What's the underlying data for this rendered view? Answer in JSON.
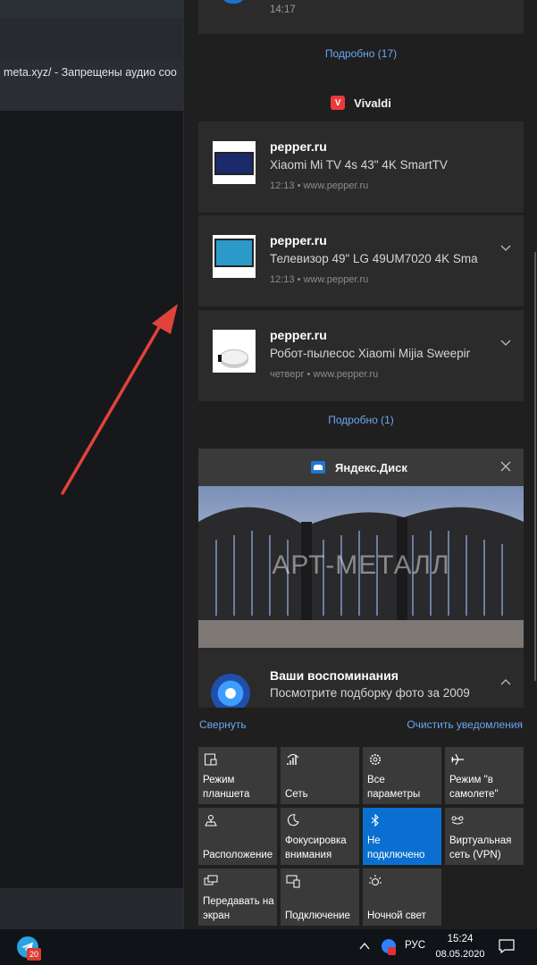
{
  "background_app": {
    "url_text": "meta.xyz/ - Запрещены аудио соо"
  },
  "action_center": {
    "top_notification": {
      "time": "14:17"
    },
    "more_link_top": "Подробно (17)",
    "vivaldi": {
      "title": "Vivaldi",
      "notifications": [
        {
          "title": "pepper.ru",
          "body": "Xiaomi Mi TV 4s 43\" 4K SmartTV",
          "meta": "12:13 • www.pepper.ru"
        },
        {
          "title": "pepper.ru",
          "body": "Телевизор 49\" LG 49UM7020 4K Sma",
          "meta": "12:13 • www.pepper.ru"
        },
        {
          "title": "pepper.ru",
          "body": "Робот-пылесос Xiaomi Mijia Sweepir",
          "meta": "четверг • www.pepper.ru"
        }
      ],
      "more_link": "Подробно (1)"
    },
    "yandex_disk": {
      "title": "Яндекс.Диск",
      "watermark": "АРТ-МЕТАЛЛ",
      "memory_title": "Ваши воспоминания",
      "memory_body": "Посмотрите подборку фото за 2009"
    },
    "collapse_label": "Свернуть",
    "clear_label": "Очистить уведомления",
    "quick_actions": [
      {
        "icon": "tablet-mode-icon",
        "label": "Режим планшета",
        "active": false
      },
      {
        "icon": "network-icon",
        "label": "Сеть",
        "active": false
      },
      {
        "icon": "settings-icon",
        "label": "Все параметры",
        "active": false
      },
      {
        "icon": "airplane-icon",
        "label": "Режим \"в самолете\"",
        "active": false
      },
      {
        "icon": "location-icon",
        "label": "Расположение",
        "active": false
      },
      {
        "icon": "focus-assist-icon",
        "label": "Фокусировка внимания",
        "active": false
      },
      {
        "icon": "bluetooth-icon",
        "label": "Не подключено",
        "active": true
      },
      {
        "icon": "vpn-icon",
        "label": "Виртуальная сеть (VPN)",
        "active": false
      },
      {
        "icon": "project-icon",
        "label": "Передавать на экран",
        "active": false
      },
      {
        "icon": "connect-icon",
        "label": "Подключение",
        "active": false
      },
      {
        "icon": "night-light-icon",
        "label": "Ночной свет",
        "active": false
      }
    ]
  },
  "taskbar": {
    "telegram_badge": "20",
    "language": "РУС",
    "time": "15:24",
    "date": "08.05.2020"
  },
  "colors": {
    "accent": "#0a6fd0",
    "link": "#6aa8f2",
    "arrow": "#e0433a"
  }
}
